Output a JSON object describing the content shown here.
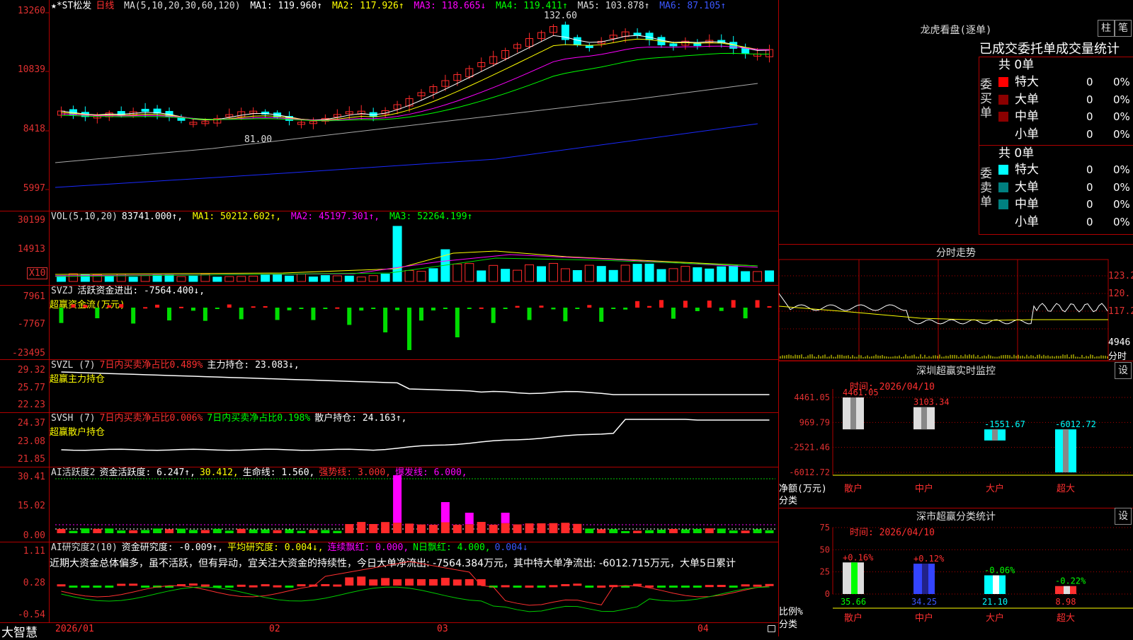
{
  "colors": {
    "up": "#ff2a2a",
    "down": "#00ffff",
    "grid": "#b00000",
    "ma1": "#ffffff",
    "ma2": "#ffff00",
    "ma3": "#ff00ff",
    "ma4": "#00ff00",
    "ma5": "#aaaaaa",
    "ma6": "#1a2aff",
    "buyBig": "#ff0000",
    "buyMid": "#8b0000",
    "sellBig": "#00ffff",
    "sellMid": "#008080",
    "inflow": "#ff1a1a",
    "outflow": "#00dd00",
    "pink": "#ff00ff"
  },
  "main": {
    "title": "★*ST松发",
    "period": "日线",
    "ma_label": "MA(5,10,20,30,60,120)",
    "ma1": "MA1: 119.960↑",
    "ma2": "MA2: 117.926↑",
    "ma3": "MA3: 118.665↓",
    "ma4": "MA4: 119.411↑",
    "ma5": "MA5: 103.878↑",
    "ma6": "MA6: 87.105↑",
    "axis": [
      "13260",
      "10839",
      "8418",
      "5997"
    ],
    "high_mark": "132.60",
    "low_mark": "81.00"
  },
  "vol": {
    "label": "VOL(5,10,20)",
    "value": "83741.000↑,",
    "ma1": "MA1: 50212.602↑,",
    "ma2": "MA2: 45197.301↑,",
    "ma3": "MA3: 52264.199↑",
    "axis": [
      "30199",
      "14913"
    ],
    "unit": "X10"
  },
  "svzj": {
    "label": "SVZJ",
    "desc": "活跃资金进出: -7564.400↓,",
    "sub": "超赢资金流(万元)",
    "axis": [
      "7961",
      "-7767",
      "-23495"
    ]
  },
  "svzl": {
    "label": "SVZL (7)",
    "desc1": "7日内买卖净占比0.489%",
    "desc2": "主力持仓: 23.083↓,",
    "sub": "超赢主力持仓",
    "axis": [
      "29.32",
      "25.77",
      "22.23"
    ]
  },
  "svsh": {
    "label": "SVSH (7)",
    "desc1": "7日内买卖净占比0.006%",
    "desc2": "7日内买卖净占比0.198%",
    "desc3": "散户持仓: 24.163↑,",
    "sub": "超赢散户持仓",
    "axis": [
      "24.37",
      "23.08",
      "21.85"
    ]
  },
  "ai2": {
    "label": "AI活跃度2",
    "d1": "资金活跃度: 6.247↑,",
    "d2": "30.412,",
    "d3": "生命线: 1.560,",
    "d4": "强势线: 3.000,",
    "d5": "爆发线: 6.000,",
    "axis": [
      "30.41",
      "15.02",
      "0.00"
    ]
  },
  "ai3": {
    "label": "AI研究度2(10)",
    "d1": "资金研究度: -0.009↑,",
    "d2": "平均研究度: 0.004↓,",
    "d3": "连续飘红: 0.000,",
    "d4": "N日飘红: 4.000,",
    "d5": "0.004↓",
    "comment": "近期大资金总体偏多，虽不活跃，但有异动，宜关注大资金的持续性，今日大单净流出: -7564.384万元，其中特大单净流出: -6012.715万元，大单5日累计",
    "axis": [
      "1.11",
      "0.28",
      "-0.54"
    ]
  },
  "xaxis": {
    "logo": "大智慧",
    "labels": [
      "2026/01",
      "02",
      "03",
      "04"
    ]
  },
  "longhu": {
    "title": "龙虎看盘(逐单)",
    "btn_bar": "柱",
    "btn_pen": "笔",
    "header": "已成交委托单成交量统计",
    "buy_label": "委买单",
    "buy_total": "共 0单",
    "sell_label": "委卖单",
    "sell_total": "共 0单",
    "buy_rows": [
      {
        "name": "特大",
        "n": "0",
        "p": "0%"
      },
      {
        "name": "大单",
        "n": "0",
        "p": "0%"
      },
      {
        "name": "中单",
        "n": "0",
        "p": "0%"
      },
      {
        "name": "小单",
        "n": "0",
        "p": "0%"
      }
    ],
    "sell_rows": [
      {
        "name": "特大",
        "n": "0",
        "p": "0%"
      },
      {
        "name": "大单",
        "n": "0",
        "p": "0%"
      },
      {
        "name": "中单",
        "n": "0",
        "p": "0%"
      },
      {
        "name": "小单",
        "n": "0",
        "p": "0%"
      }
    ]
  },
  "intraday": {
    "title": "分时走势",
    "axis": [
      "123.2",
      "120.",
      "117.2"
    ],
    "vol_axis": "4946",
    "vol_label": "分时"
  },
  "monitor": {
    "title": "深圳超赢实时监控",
    "btn": "设",
    "time": "时间: 2026/04/10",
    "axis": [
      "4461.05",
      "969.79",
      "-2521.46",
      "-6012.72"
    ],
    "ylabel": "净额(万元)",
    "xlabel": "分类",
    "categories": [
      "散户",
      "中户",
      "大户",
      "超大"
    ],
    "values": [
      4461.05,
      3103.34,
      -1551.67,
      -6012.72
    ],
    "labels": [
      "4461.05",
      "3103.34",
      "-1551.67",
      "-6012.72"
    ]
  },
  "classify": {
    "title": "深市超赢分类统计",
    "btn": "设",
    "time": "时间: 2026/04/10",
    "axis": [
      "75",
      "50",
      "25",
      "0"
    ],
    "ylabel": "比例%",
    "xlabel": "分类",
    "categories": [
      "散户",
      "中户",
      "大户",
      "超大"
    ],
    "values": [
      35.66,
      34.25,
      21.1,
      8.98
    ],
    "labels": [
      "35.66",
      "34.25",
      "21.10",
      "8.98"
    ],
    "changes": [
      "+0.16%",
      "+0.12%",
      "-0.06%",
      "-0.22%"
    ]
  },
  "chart_data": [
    {
      "type": "bar",
      "title": "深圳超赢实时监控",
      "ylabel": "净额(万元)",
      "xlabel": "分类",
      "categories": [
        "散户",
        "中户",
        "大户",
        "超大"
      ],
      "values": [
        4461.05,
        3103.34,
        -1551.67,
        -6012.72
      ],
      "ylim": [
        -6012.72,
        4461.05
      ]
    },
    {
      "type": "bar",
      "title": "深市超赢分类统计",
      "ylabel": "比例%",
      "xlabel": "分类",
      "categories": [
        "散户",
        "中户",
        "大户",
        "超大"
      ],
      "values": [
        35.66,
        34.25,
        21.1,
        8.98
      ],
      "ylim": [
        0,
        75
      ]
    }
  ]
}
